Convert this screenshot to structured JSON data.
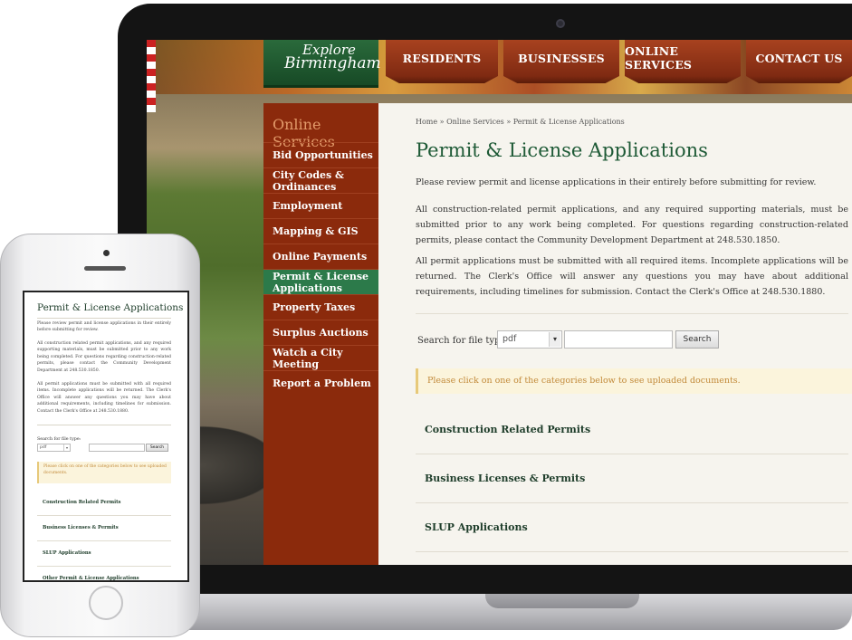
{
  "header": {
    "logo_line1": "Explore",
    "logo_line2": "Birmingham",
    "nav": [
      "RESIDENTS",
      "BUSINESSES",
      "ONLINE SERVICES",
      "CONTACT US"
    ]
  },
  "sidebar": {
    "title": "Online Services",
    "items": [
      "Bid Opportunities",
      "City Codes & Ordinances",
      "Employment",
      "Mapping & GIS",
      "Online Payments",
      "Permit & License Applications",
      "Property Taxes",
      "Surplus Auctions",
      "Watch a City Meeting",
      "Report a Problem"
    ],
    "active_index": 5
  },
  "page": {
    "breadcrumb": "Home » Online Services » Permit & License Applications",
    "title": "Permit & License Applications",
    "para1": "Please review permit and license applications in their entirely before submitting for review.",
    "para2": "All construction-related permit applications, and any required supporting materials, must be submitted prior to any work being completed. For questions regarding construction-related permits, please contact the Community Development Department at 248.530.1850.",
    "para3": "All permit applications must be submitted with all required items. Incomplete applications will be returned. The Clerk's Office will answer any questions you may have about additional requirements, including timelines for submission. Contact the Clerk's Office at 248.530.1880.",
    "search_label": "Search for file type:",
    "file_type": "pdf",
    "search_button": "Search",
    "notice": "Please click on one of the categories below to see uploaded documents.",
    "categories": [
      "Construction Related Permits",
      "Business Licenses & Permits",
      "SLUP Applications"
    ]
  },
  "mobile": {
    "title": "Permit & License Applications",
    "para1": "Please review permit and license applications in their entirely before submitting for review.",
    "para2": "All construction related permit applications, and any required supporting materials, must be submitted prior to any work being completed. For questions regarding construction-related permits, please contact the Community Development Department at 248.530.1850.",
    "para3": "All permit applications must be submitted with all required items. Incomplete applications will be returned. The Clerk's Office will answer any questions you may have about additional requirements, including timelines for submission. Contact the Clerk's Office at 248.530.1880.",
    "search_label": "Search for file type:",
    "file_type": "pdf",
    "search_button": "Search",
    "notice": "Please click on one of the categories below to see uploaded documents.",
    "categories": [
      "Construction Related Permits",
      "Business Licenses & Permits",
      "SLUP Applications",
      "Other Permit & License Applications"
    ]
  }
}
